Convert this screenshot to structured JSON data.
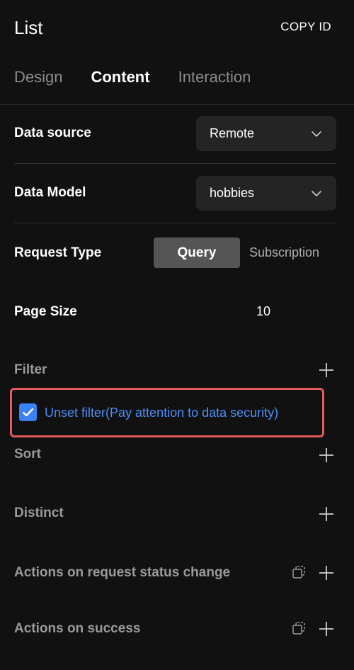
{
  "header": {
    "title": "List",
    "copy_id_label": "COPY ID"
  },
  "tabs": [
    {
      "label": "Design",
      "active": false
    },
    {
      "label": "Content",
      "active": true
    },
    {
      "label": "Interaction",
      "active": false
    }
  ],
  "data_source": {
    "label": "Data source",
    "value": "Remote"
  },
  "data_model": {
    "label": "Data Model",
    "value": "hobbies"
  },
  "request_type": {
    "label": "Request Type",
    "options": [
      "Query",
      "Subscription"
    ],
    "selected": "Query"
  },
  "page_size": {
    "label": "Page Size",
    "value": "10"
  },
  "filter": {
    "label": "Filter",
    "unset_filter_label": "Unset filter(Pay attention to data security)",
    "unset_filter_checked": true
  },
  "sort": {
    "label": "Sort"
  },
  "distinct": {
    "label": "Distinct"
  },
  "actions_status_change": {
    "label": "Actions on request status change"
  },
  "actions_success": {
    "label": "Actions on success"
  },
  "icons": {
    "chevron": "chevron-down-icon",
    "plus": "plus-icon",
    "copy": "copy-icon",
    "check": "check-icon"
  },
  "colors": {
    "background": "#111111",
    "select_bg": "#242424",
    "active_segment": "#555555",
    "accent_blue": "#3b82f6",
    "link_blue": "#4d8ef7",
    "highlight_red": "#e25c5c"
  }
}
